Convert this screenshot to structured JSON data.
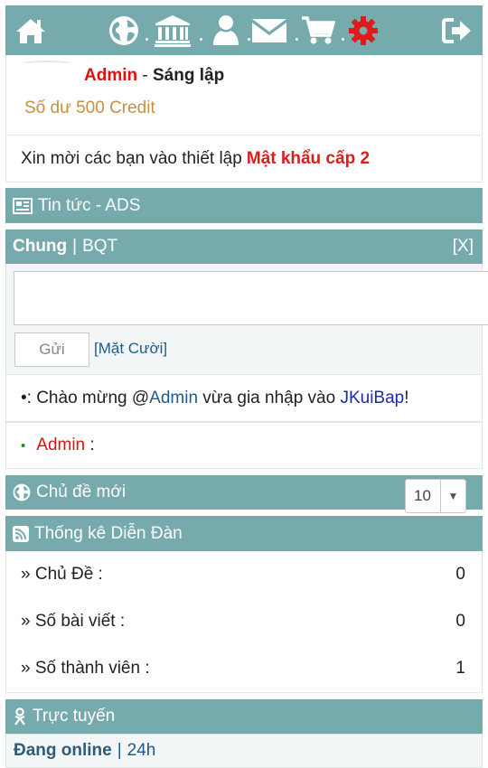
{
  "nav": {
    "icons": [
      "home-icon",
      "globe-icon",
      "bank-icon",
      "user-icon",
      "mail-icon",
      "cart-icon",
      "gear-icon",
      "logout-icon"
    ],
    "colors": {
      "bar": "#77aaac",
      "active": "#e01b1b"
    }
  },
  "profile": {
    "name": "Admin",
    "separator": "-",
    "role": "Sáng lập",
    "balance": "Số dư 500 Credit"
  },
  "password_notice": {
    "text": "Xin mời các bạn vào thiết lập",
    "link": "Mật khẩu cấp 2"
  },
  "news": {
    "title": "Tin tức - ADS"
  },
  "chat": {
    "tab_main": "Chung",
    "pipe": "|",
    "tab_admin": "BQT",
    "close": "[X]",
    "input_value": "",
    "send": "Gửi",
    "smiley": "[Mặt Cười]",
    "messages": [
      {
        "bullet": "•",
        "prefix": ": Chào mừng @",
        "user": "Admin",
        "middle": " vừa gia nhập vào ",
        "site": "JKuiBap",
        "suffix": "!"
      },
      {
        "bullet": "•",
        "user": "Admin",
        "suffix": " :"
      }
    ]
  },
  "topics": {
    "title": "Chủ đề mới",
    "select_value": "10",
    "arrow": "▼"
  },
  "stats": {
    "title": "Thống kê Diễn Đàn",
    "rows": [
      {
        "label": "» Chủ Đề :",
        "value": "0"
      },
      {
        "label": "» Số bài viết :",
        "value": "0"
      },
      {
        "label": "» Số thành viên :",
        "value": "1"
      }
    ]
  },
  "online": {
    "title": "Trực tuyến",
    "tab_online": "Đang online",
    "pipe": "|",
    "tab_24h": "24h"
  }
}
